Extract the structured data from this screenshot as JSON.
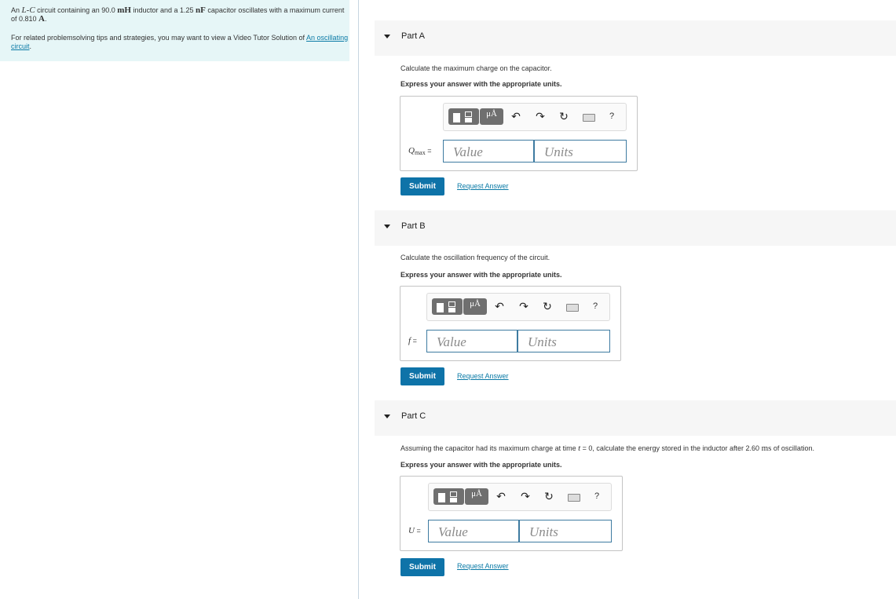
{
  "problem": {
    "p1": "An ",
    "lc_L": "L",
    "lc_dash": "-",
    "lc_C": "C",
    "p2": " circuit containing an 90.0 ",
    "unit_mH": "mH",
    "p3": " inductor and a 1.25 ",
    "unit_nF": "nF",
    "p4": " capacitor oscillates with a maximum current of 0.810 ",
    "unit_A": "A",
    "p5": "."
  },
  "tip": {
    "text": "For related problemsolving tips and strategies, you may want to view a Video Tutor Solution of ",
    "link": "An oscillating circuit",
    "end": "."
  },
  "toolbar": {
    "units_glyph": "μÅ",
    "undo_glyph": "↶",
    "redo_glyph": "↷",
    "reset_glyph": "↻",
    "help_glyph": "?"
  },
  "common": {
    "value_placeholder": "Value",
    "units_placeholder": "Units",
    "submit_label": "Submit",
    "request_label": "Request Answer",
    "instruction": "Express your answer with the appropriate units."
  },
  "partA": {
    "label": "Part A",
    "question": "Calculate the maximum charge on the capacitor.",
    "var": "Q",
    "var_sub": "max",
    "eq": " ="
  },
  "partB": {
    "label": "Part B",
    "question": "Calculate the oscillation frequency of the circuit.",
    "var": "f",
    "eq": " ="
  },
  "partC": {
    "label": "Part C",
    "q1": "Assuming the capacitor had its maximum charge at time ",
    "q_t": "t",
    "q2": " = 0, calculate the energy stored in the inductor after 2.60 ",
    "q_ms": "ms",
    "q3": " of oscillation.",
    "var": "U",
    "eq": " ="
  }
}
